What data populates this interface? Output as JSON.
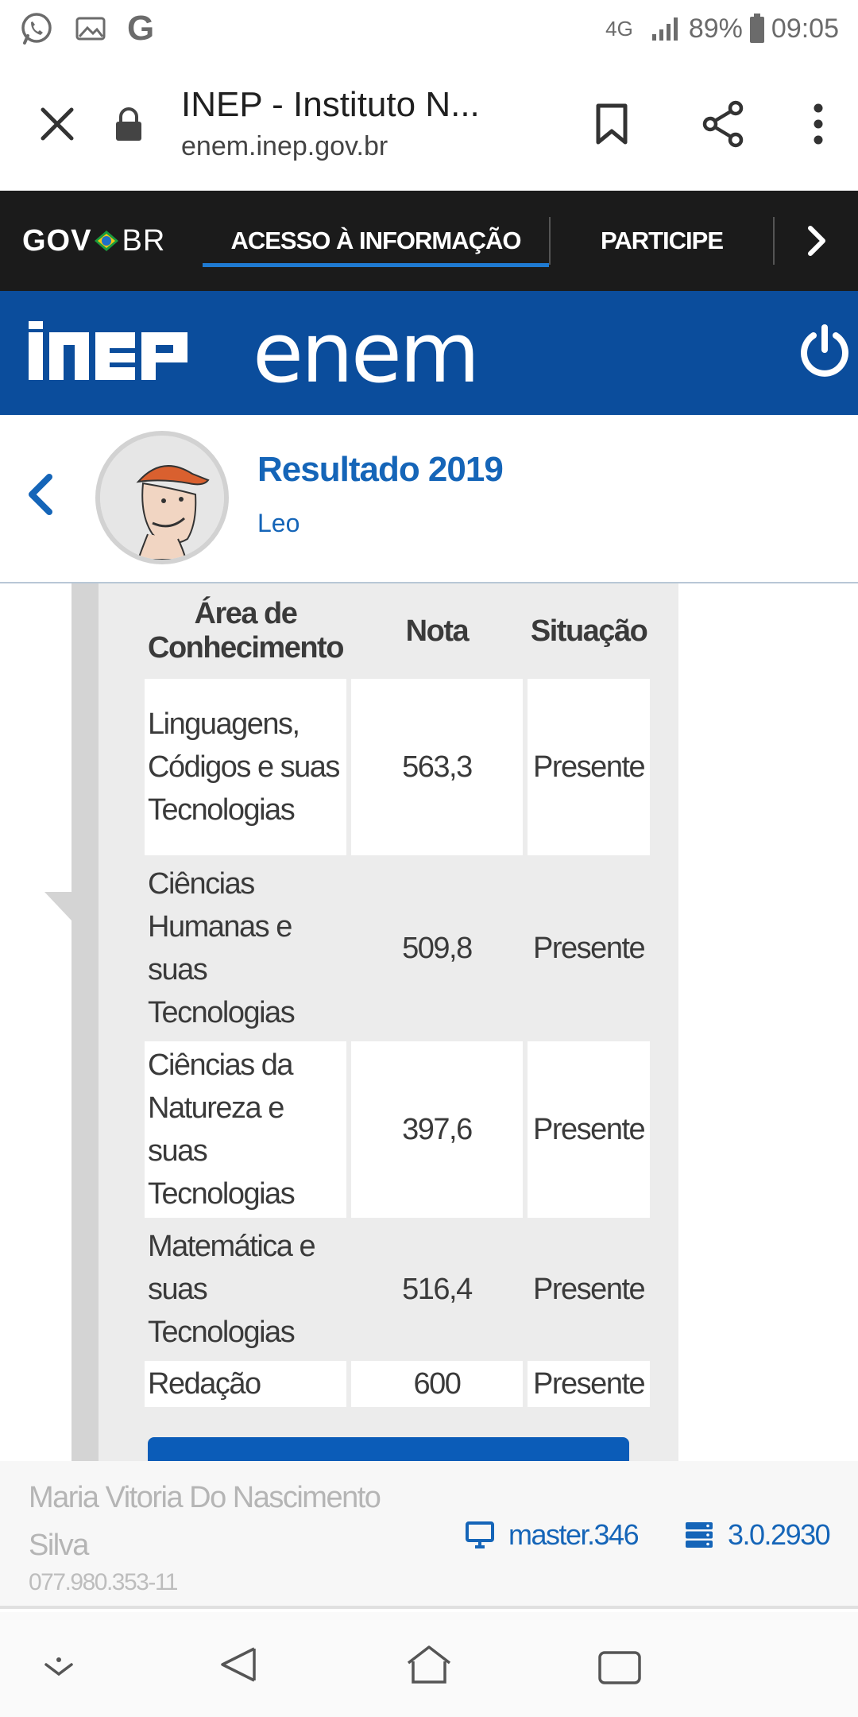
{
  "status_bar": {
    "network": "4G",
    "battery": "89%",
    "time": "09:05",
    "left_icons": [
      "whatsapp-icon",
      "gallery-icon",
      "google-icon"
    ]
  },
  "browser": {
    "page_title": "INEP - Instituto N...",
    "url": "enem.inep.gov.br"
  },
  "gov_bar": {
    "logo_gov": "GOV",
    "logo_br": "BR",
    "links": [
      "ACESSO À INFORMAÇÃO",
      "PARTICIPE"
    ]
  },
  "header": {
    "inep_logo": "INEP",
    "enem_logo": "enem"
  },
  "profile": {
    "title": "Resultado 2019",
    "subtitle": "Leo"
  },
  "grades_table": {
    "headers": [
      "Área de Conhecimento",
      "Nota",
      "Situação"
    ],
    "rows": [
      {
        "area": "Linguagens, Códigos e suas Tecnologias",
        "nota": "563,3",
        "situacao": "Presente"
      },
      {
        "area": "Ciências Humanas e suas Tecnologias",
        "nota": "509,8",
        "situacao": "Presente"
      },
      {
        "area": "Ciências da Natureza e suas Tecnologias",
        "nota": "397,6",
        "situacao": "Presente"
      },
      {
        "area": "Matemática e suas Tecnologias",
        "nota": "516,4",
        "situacao": "Presente"
      },
      {
        "area": "Redação",
        "nota": "600",
        "situacao": "Presente"
      }
    ]
  },
  "footer": {
    "user_name": "Maria Vitoria Do Nascimento Silva",
    "cpf": "077.980.353-11",
    "client_version": "master.346",
    "server_version": "3.0.2930"
  },
  "colors": {
    "brand_blue": "#0b4d9c",
    "link_blue": "#1565b8",
    "gov_dark": "#1b1b1b"
  }
}
